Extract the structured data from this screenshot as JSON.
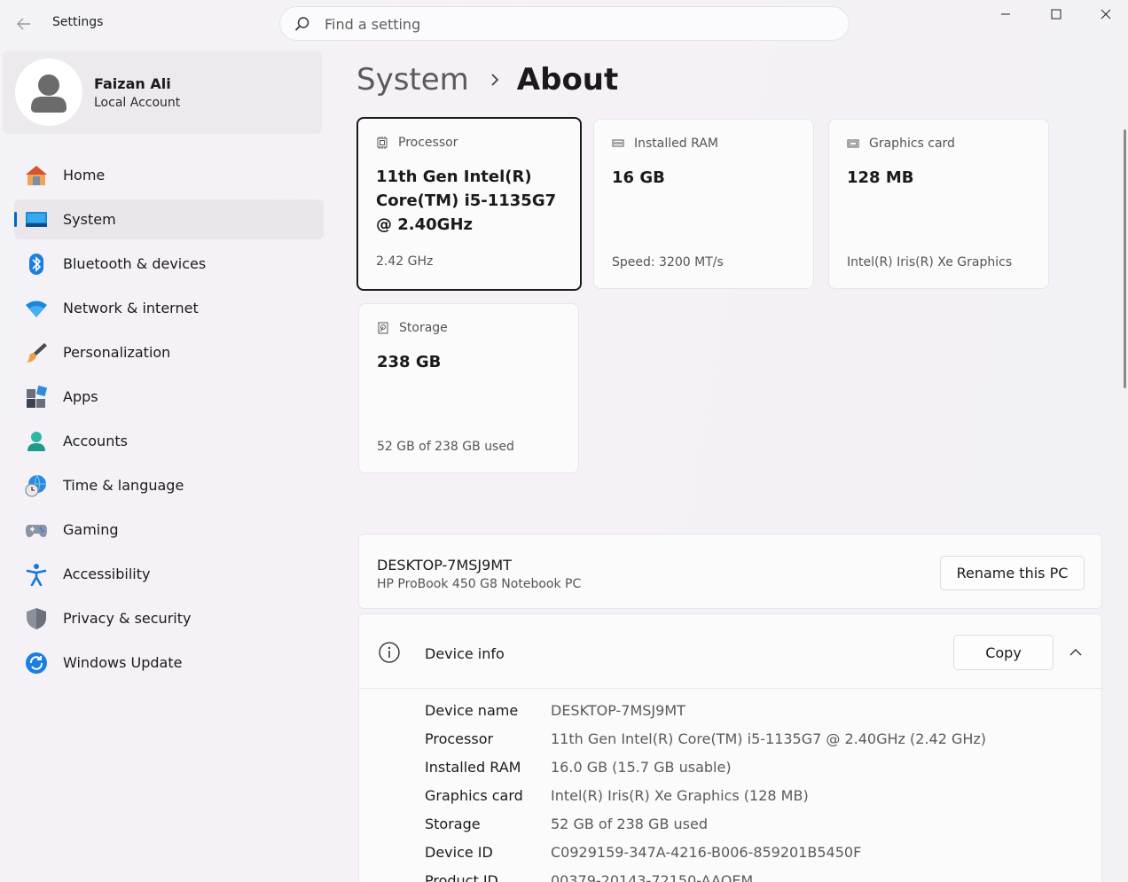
{
  "titlebar": {
    "app_title": "Settings",
    "search_placeholder": "Find a setting"
  },
  "profile": {
    "name": "Faizan Ali",
    "account_type": "Local Account"
  },
  "sidebar": {
    "items": [
      {
        "label": "Home",
        "icon": "home-icon"
      },
      {
        "label": "System",
        "icon": "system-icon",
        "active": true
      },
      {
        "label": "Bluetooth & devices",
        "icon": "bluetooth-icon"
      },
      {
        "label": "Network & internet",
        "icon": "wifi-icon"
      },
      {
        "label": "Personalization",
        "icon": "brush-icon"
      },
      {
        "label": "Apps",
        "icon": "apps-icon"
      },
      {
        "label": "Accounts",
        "icon": "person-icon"
      },
      {
        "label": "Time & language",
        "icon": "globe-clock-icon"
      },
      {
        "label": "Gaming",
        "icon": "gamepad-icon"
      },
      {
        "label": "Accessibility",
        "icon": "accessibility-icon"
      },
      {
        "label": "Privacy & security",
        "icon": "shield-icon"
      },
      {
        "label": "Windows Update",
        "icon": "update-icon"
      }
    ]
  },
  "breadcrumb": {
    "parent": "System",
    "current": "About"
  },
  "specs": {
    "processor": {
      "label": "Processor",
      "value": "11th Gen Intel(R) Core(TM) i5-1135G7 @ 2.40GHz",
      "detail": "2.42 GHz",
      "icon": "chip-icon"
    },
    "ram": {
      "label": "Installed RAM",
      "value": "16 GB",
      "detail": "Speed: 3200 MT/s",
      "icon": "ram-icon"
    },
    "graphics": {
      "label": "Graphics card",
      "value": "128 MB",
      "detail": "Intel(R) Iris(R) Xe Graphics",
      "icon": "gpu-icon"
    },
    "storage": {
      "label": "Storage",
      "value": "238 GB",
      "detail": "52 GB of 238 GB used",
      "icon": "drive-icon"
    }
  },
  "pc": {
    "name": "DESKTOP-7MSJ9MT",
    "model": "HP ProBook 450 G8 Notebook PC",
    "rename_label": "Rename this PC"
  },
  "device_info": {
    "title": "Device info",
    "copy_label": "Copy",
    "rows": [
      {
        "label": "Device name",
        "value": "DESKTOP-7MSJ9MT"
      },
      {
        "label": "Processor",
        "value": "11th Gen Intel(R) Core(TM) i5-1135G7 @ 2.40GHz (2.42 GHz)"
      },
      {
        "label": "Installed RAM",
        "value": "16.0 GB (15.7 GB usable)"
      },
      {
        "label": "Graphics card",
        "value": "Intel(R) Iris(R) Xe Graphics (128 MB)"
      },
      {
        "label": "Storage",
        "value": "52 GB of 238 GB used"
      },
      {
        "label": "Device ID",
        "value": "C0929159-347A-4216-B006-859201B5450F"
      },
      {
        "label": "Product ID",
        "value": "00379-20143-72150-AAOEM"
      }
    ]
  },
  "colors": {
    "accent": "#0067c0"
  }
}
